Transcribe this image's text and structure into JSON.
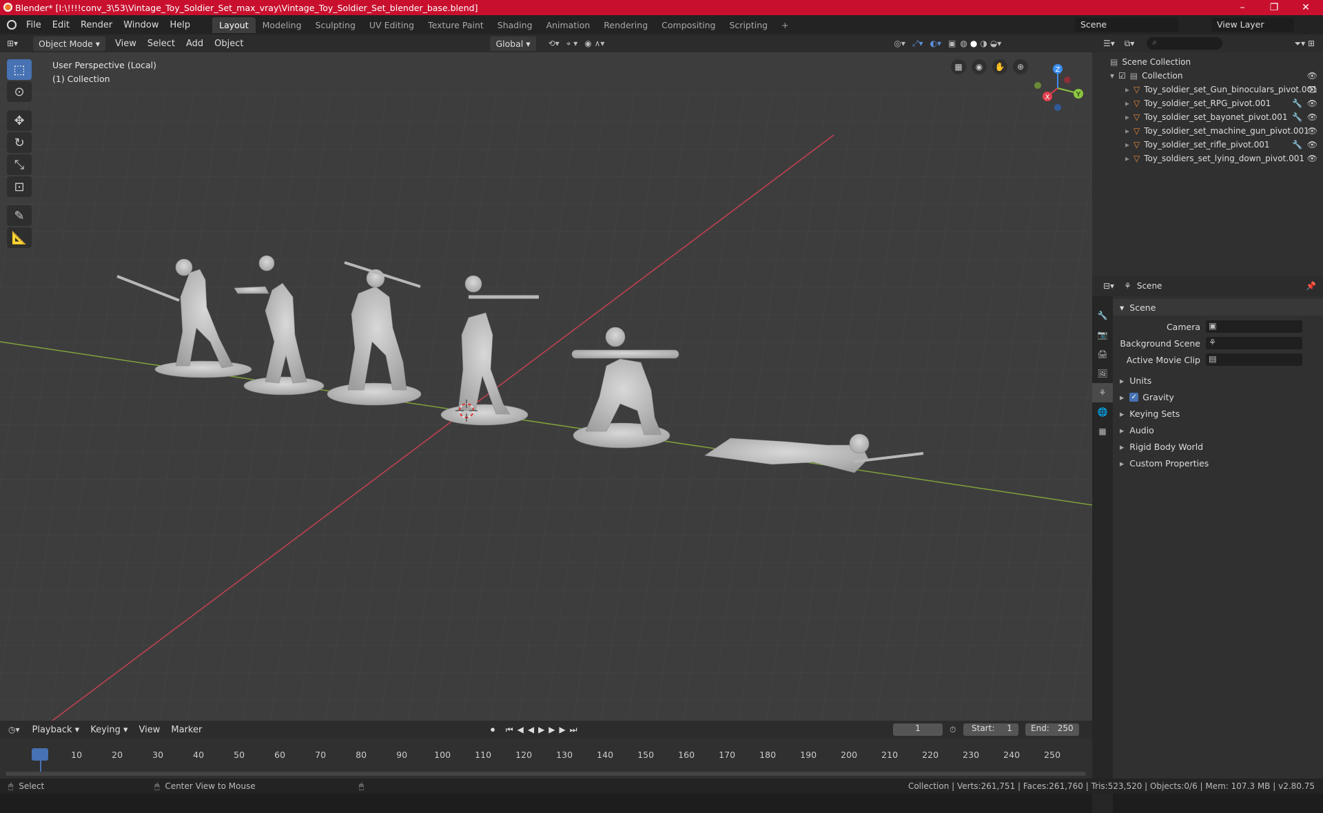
{
  "window": {
    "title": "Blender* [I:\\!!!!conv_3\\53\\Vintage_Toy_Soldier_Set_max_vray\\Vintage_Toy_Soldier_Set_blender_base.blend]",
    "minimize": "–",
    "maximize": "❐",
    "close": "✕"
  },
  "menu": {
    "file": "File",
    "edit": "Edit",
    "render": "Render",
    "window": "Window",
    "help": "Help"
  },
  "workspaces": [
    "Layout",
    "Modeling",
    "Sculpting",
    "UV Editing",
    "Texture Paint",
    "Shading",
    "Animation",
    "Rendering",
    "Compositing",
    "Scripting"
  ],
  "workspace_add": "+",
  "scene_field": "Scene",
  "view_layer_field": "View Layer",
  "viewport_header": {
    "mode": "Object Mode",
    "view": "View",
    "select": "Select",
    "add": "Add",
    "object": "Object",
    "orientation": "Global"
  },
  "viewport_overlay": {
    "perspective": "User Perspective (Local)",
    "collection": "(1) Collection"
  },
  "gizmo": {
    "x": "X",
    "y": "Y",
    "z": "Z"
  },
  "outliner": {
    "root": "Scene Collection",
    "collection": "Collection",
    "items": [
      {
        "name": "Toy_soldier_set_Gun_binoculars_pivot.001"
      },
      {
        "name": "Toy_soldier_set_RPG_pivot.001"
      },
      {
        "name": "Toy_soldier_set_bayonet_pivot.001"
      },
      {
        "name": "Toy_soldier_set_machine_gun_pivot.001"
      },
      {
        "name": "Toy_soldier_set_rifle_pivot.001"
      },
      {
        "name": "Toy_soldiers_set_lying_down_pivot.001"
      }
    ]
  },
  "properties": {
    "header": "Scene",
    "panel": "Scene",
    "camera_label": "Camera",
    "background_label": "Background Scene",
    "movieclip_label": "Active Movie Clip",
    "sections": [
      "Units",
      "Gravity",
      "Keying Sets",
      "Audio",
      "Rigid Body World",
      "Custom Properties"
    ],
    "gravity_checked": true
  },
  "timeline": {
    "playback": "Playback",
    "keying": "Keying",
    "view": "View",
    "marker": "Marker",
    "current_frame": "1",
    "start_label": "Start:",
    "start": "1",
    "end_label": "End:",
    "end": "250",
    "ticks": [
      "1",
      "10",
      "20",
      "30",
      "40",
      "50",
      "60",
      "70",
      "80",
      "90",
      "100",
      "110",
      "120",
      "130",
      "140",
      "150",
      "160",
      "170",
      "180",
      "190",
      "200",
      "210",
      "220",
      "230",
      "240",
      "250"
    ]
  },
  "status": {
    "select": "Select",
    "center": "Center View to Mouse",
    "info": "Collection | Verts:261,751 | Faces:261,760 | Tris:523,520 | Objects:0/6 | Mem: 107.3 MB | v2.80.75"
  },
  "colors": {
    "accent": "#4772b3",
    "title_bar": "#c8102e",
    "x_axis": "#e0404f",
    "y_axis": "#8cc63f",
    "z_axis": "#3b8ff0"
  }
}
